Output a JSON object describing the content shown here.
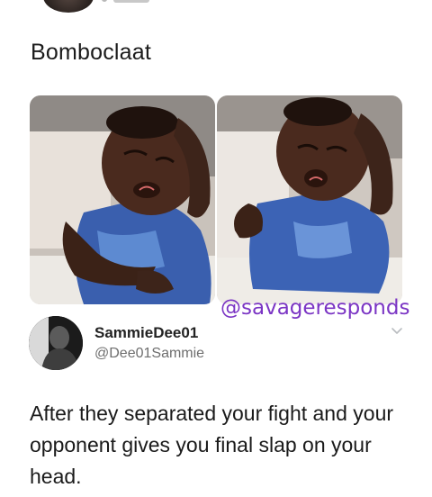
{
  "caption": "Bomboclaat",
  "watermark": "@savageresponds",
  "tweet": {
    "display_name": "SammieDee01",
    "handle": "@Dee01Sammie",
    "text": "After they separated your fight and your opponent gives you final slap on your head."
  },
  "icons": {
    "more": "chevron-down-icon"
  },
  "colors": {
    "watermark": "#7b35c4",
    "handle": "#6e6e6e"
  }
}
